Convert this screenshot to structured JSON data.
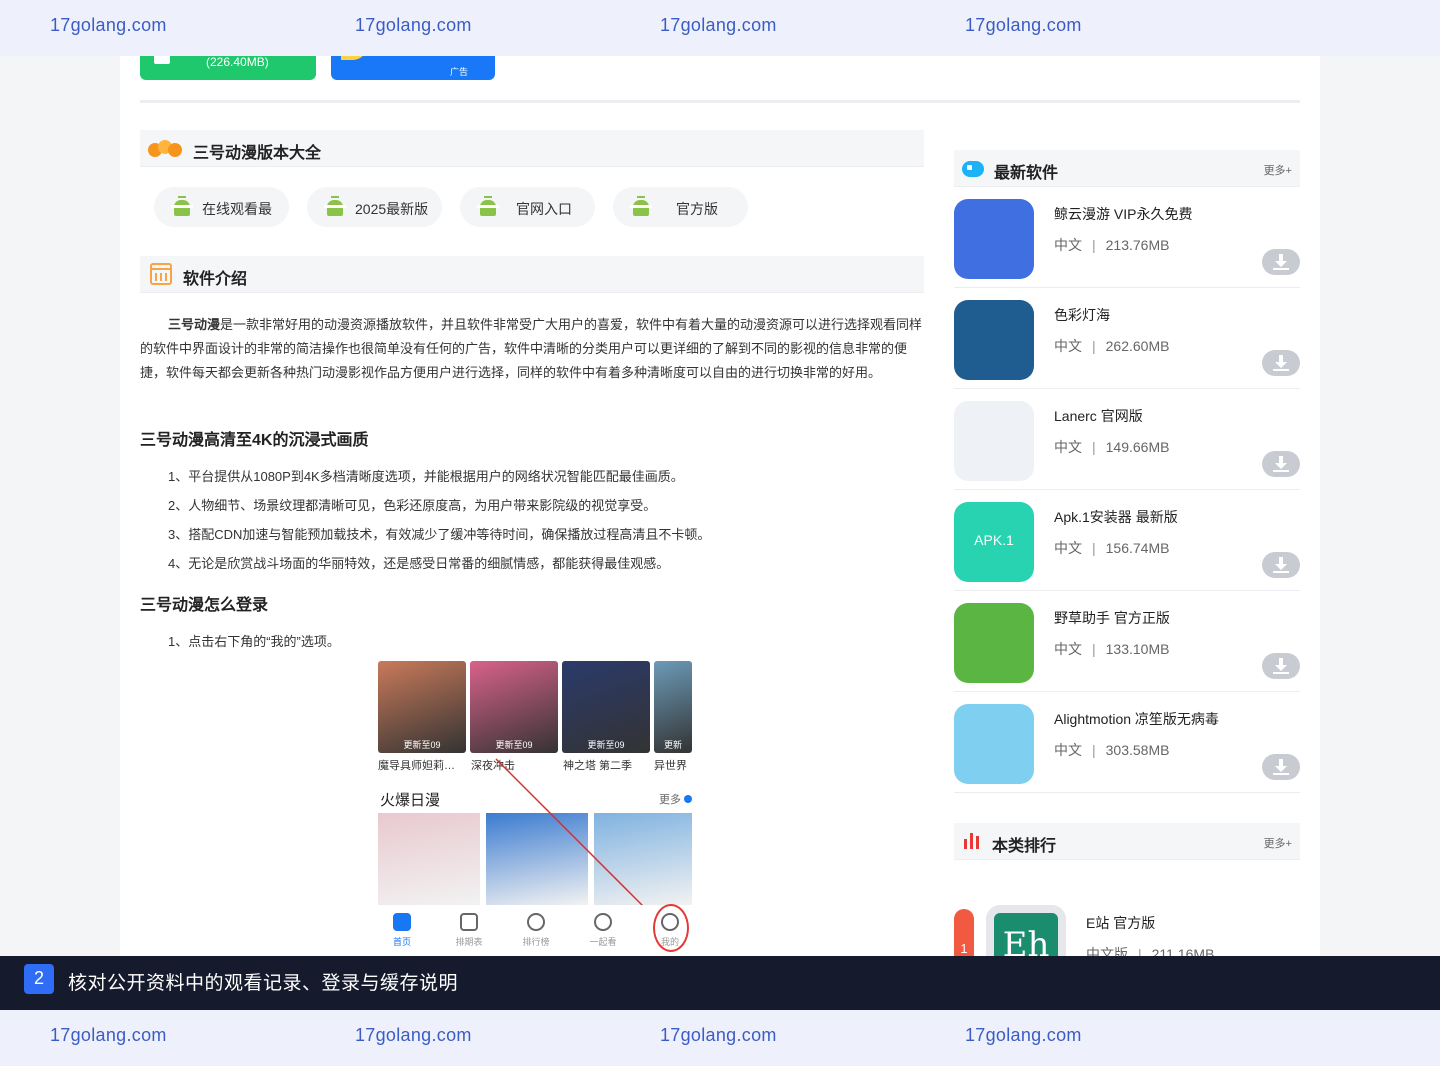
{
  "watermarks": [
    "17golang.com",
    "17golang.com",
    "17golang.com",
    "17golang.com"
  ],
  "top_buttons": {
    "green_size": "(226.40MB)",
    "blue_ad": "广告"
  },
  "versions": {
    "title": "三号动漫版本大全",
    "tags": [
      "在线观看最",
      "2025最新版",
      "官网入口",
      "官方版"
    ]
  },
  "intro": {
    "title": "软件介绍",
    "app_name": "三号动漫",
    "p1": "是一款非常好用的动漫资源播放软件，并且软件非常受广大用户的喜爱，软件中有着大量的动漫资源可以进行选择观看同样的软件中界面设计的非常的简洁操作也很简单没有任何的广告，软件中清晰的分类用户可以更详细的了解到不同的影视的信息非常的便捷，软件每天都会更新各种热门动漫影视作品方便用户进行选择，同样的软件中有着多种清晰度可以自由的进行切换非常的好用。",
    "h3_1": "三号动漫高清至4K的沉浸式画质",
    "list1": [
      "1、平台提供从1080P到4K多档清晰度选项，并能根据用户的网络状况智能匹配最佳画质。",
      "2、人物细节、场景纹理都清晰可见，色彩还原度高，为用户带来影院级的视觉享受。",
      "3、搭配CDN加速与智能预加载技术，有效减少了缓冲等待时间，确保播放过程高清且不卡顿。",
      "4、无论是欣赏战斗场面的华丽特效，还是感受日常番的细腻情感，都能获得最佳观感。"
    ],
    "h3_2": "三号动漫怎么登录",
    "list2": [
      "1、点击右下角的“我的”选项。"
    ]
  },
  "screenshot": {
    "cards": [
      {
        "badge": "更新至09",
        "caption": "魔导具师妲莉…",
        "color": "#c97a5a"
      },
      {
        "badge": "更新至09",
        "caption": "深夜冲击",
        "color": "#d9628a"
      },
      {
        "badge": "更新至09",
        "caption": "神之塔 第二季",
        "color": "#2b3a6b"
      },
      {
        "badge": "更新",
        "caption": "异世界",
        "color": "#6c9bb8"
      }
    ],
    "section_title": "火爆日漫",
    "more": "更多",
    "big_colors": [
      "#e8c9cf",
      "#3b7bd0",
      "#7fb2e0"
    ],
    "tabs": [
      "首页",
      "排期表",
      "排行榜",
      "一起看",
      "我的"
    ]
  },
  "latest": {
    "title": "最新软件",
    "more": "更多+",
    "apps": [
      {
        "name": "鲸云漫游 VIP永久免费",
        "lang": "中文",
        "size": "213.76MB",
        "color": "#3f6fe0"
      },
      {
        "name": "色彩灯海",
        "lang": "中文",
        "size": "262.60MB",
        "color": "#1f5c8f"
      },
      {
        "name": "Lanerc 官网版",
        "lang": "中文",
        "size": "149.66MB",
        "color": "#eef1f5"
      },
      {
        "name": "Apk.1安装器 最新版",
        "lang": "中文",
        "size": "156.74MB",
        "color": "#27d3b0",
        "icon_text": "APK.1"
      },
      {
        "name": "野草助手 官方正版",
        "lang": "中文",
        "size": "133.10MB",
        "color": "#5bb543"
      },
      {
        "name": "Alightmotion 凉笙版无病毒",
        "lang": "中文",
        "size": "303.58MB",
        "color": "#7fd0f0"
      }
    ]
  },
  "ranking": {
    "title": "本类排行",
    "more": "更多+",
    "items": [
      {
        "rank": "1",
        "name": "E站 官方版",
        "lang": "中文版",
        "size": "211.16MB",
        "icon_text": "Eh"
      }
    ]
  },
  "banner": {
    "step": "2",
    "text": "核对公开资料中的观看记录、登录与缓存说明"
  }
}
